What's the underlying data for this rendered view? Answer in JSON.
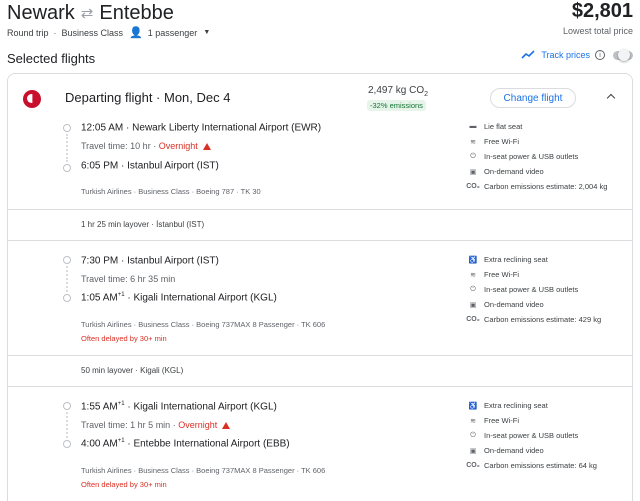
{
  "header": {
    "origin": "Newark",
    "destination": "Entebbe",
    "trip_type": "Round trip",
    "cabin": "Business Class",
    "passengers": "1 passenger",
    "price": "$2,801",
    "price_caption": "Lowest total price"
  },
  "selected_flights_title": "Selected flights",
  "track_prices_label": "Track prices",
  "departing": {
    "title": "Departing flight · Mon, Dec 4",
    "co2_value": "2,497 kg CO",
    "co2_sub": "2",
    "emissions_badge": "-32% emissions",
    "change_label": "Change flight"
  },
  "segments": [
    {
      "dep_time": "12:05 AM",
      "dep_time_sup": "",
      "dep_airport": "Newark Liberty International Airport (EWR)",
      "travel_time": "Travel time: 10 hr",
      "overnight": "Overnight",
      "arr_time": "6:05 PM",
      "arr_time_sup": "",
      "arr_airport": "Istanbul Airport (IST)",
      "meta": "Turkish Airlines · Business Class · Boeing 787 · TK 30",
      "delay": "",
      "amenities": [
        {
          "icon": "lie-flat-seat-icon",
          "label": "Lie flat seat"
        },
        {
          "icon": "wifi-icon",
          "label": "Free Wi-Fi"
        },
        {
          "icon": "power-plug-icon",
          "label": "In-seat power & USB outlets"
        },
        {
          "icon": "video-icon",
          "label": "On-demand video"
        },
        {
          "icon": "co2-icon",
          "label": "Carbon emissions estimate: 2,004 kg"
        }
      ]
    },
    {
      "dep_time": "7:30 PM",
      "dep_time_sup": "",
      "dep_airport": "Istanbul Airport (IST)",
      "travel_time": "Travel time: 6 hr 35 min",
      "overnight": "",
      "arr_time": "1:05 AM",
      "arr_time_sup": "+1",
      "arr_airport": "Kigali International Airport (KGL)",
      "meta": "Turkish Airlines · Business Class · Boeing 737MAX 8 Passenger · TK 606",
      "delay": "Often delayed by 30+ min",
      "amenities": [
        {
          "icon": "reclining-seat-icon",
          "label": "Extra reclining seat"
        },
        {
          "icon": "wifi-icon",
          "label": "Free Wi-Fi"
        },
        {
          "icon": "power-plug-icon",
          "label": "In-seat power & USB outlets"
        },
        {
          "icon": "video-icon",
          "label": "On-demand video"
        },
        {
          "icon": "co2-icon",
          "label": "Carbon emissions estimate: 429 kg"
        }
      ]
    },
    {
      "dep_time": "1:55 AM",
      "dep_time_sup": "+1",
      "dep_airport": "Kigali International Airport (KGL)",
      "travel_time": "Travel time: 1 hr 5 min",
      "overnight": "Overnight",
      "arr_time": "4:00 AM",
      "arr_time_sup": "+1",
      "arr_airport": "Entebbe International Airport (EBB)",
      "meta": "Turkish Airlines · Business Class · Boeing 737MAX 8 Passenger · TK 606",
      "delay": "Often delayed by 30+ min",
      "amenities": [
        {
          "icon": "reclining-seat-icon",
          "label": "Extra reclining seat"
        },
        {
          "icon": "wifi-icon",
          "label": "Free Wi-Fi"
        },
        {
          "icon": "power-plug-icon",
          "label": "In-seat power & USB outlets"
        },
        {
          "icon": "video-icon",
          "label": "On-demand video"
        },
        {
          "icon": "co2-icon",
          "label": "Carbon emissions estimate: 64 kg"
        }
      ]
    }
  ],
  "layovers": [
    "1 hr 25 min layover · İstanbul (IST)",
    "50 min layover · Kigali (KGL)"
  ],
  "colors": {
    "accent": "#1a73e8",
    "warning": "#d93025",
    "emissions_green": "#137333",
    "brand_turkish": "#c8102e"
  }
}
